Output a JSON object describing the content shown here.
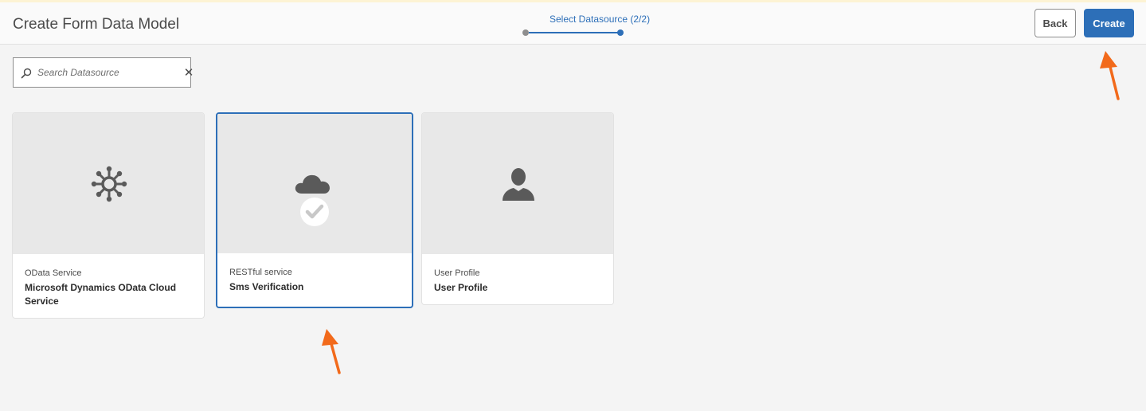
{
  "header": {
    "title": "Create Form Data Model",
    "wizard_step_label": "Select Datasource (2/2)",
    "back_label": "Back",
    "create_label": "Create"
  },
  "search": {
    "placeholder": "Search Datasource",
    "value": ""
  },
  "datasources": [
    {
      "kind": "OData Service",
      "name": "Microsoft Dynamics OData Cloud Service",
      "icon": "network-hub-icon",
      "selected": false
    },
    {
      "kind": "RESTful service",
      "name": "Sms Verification",
      "icon": "cloud-icon",
      "selected": true
    },
    {
      "kind": "User Profile",
      "name": "User Profile",
      "icon": "user-icon",
      "selected": false
    }
  ],
  "colors": {
    "accent": "#2d6fb8",
    "annotation_arrow": "#f26a1b"
  }
}
